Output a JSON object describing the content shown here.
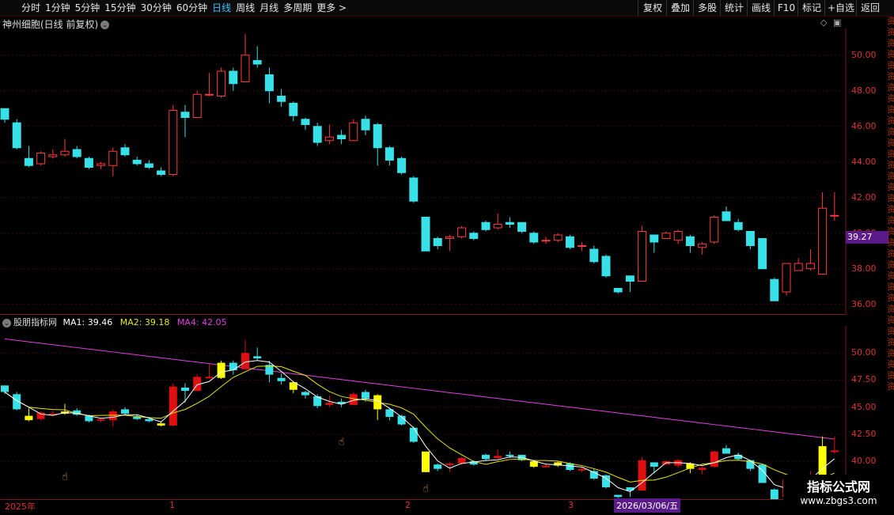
{
  "toolbar": {
    "periods": [
      "分时",
      "1分钟",
      "5分钟",
      "15分钟",
      "30分钟",
      "60分钟",
      "日线",
      "周线",
      "月线",
      "多周期",
      "更多 >"
    ],
    "active_period": "日线",
    "right_buttons": [
      "复权",
      "叠加",
      "多股",
      "统计",
      "画线",
      "F10",
      "标记",
      "+自选",
      "返回"
    ]
  },
  "main_panel": {
    "title": "神州细胞(日线 前复权)",
    "y_ticks": [
      "50.00",
      "48.00",
      "46.00",
      "44.00",
      "42.00",
      "40.00",
      "38.00",
      "36.00"
    ],
    "current_price": "39.27"
  },
  "indicator_panel": {
    "name": "股朋指标网",
    "ma1_label": "MA1: 39.46",
    "ma2_label": "MA2: 39.18",
    "ma4_label": "MA4: 42.05",
    "y_ticks": [
      "50.00",
      "47.50",
      "45.00",
      "42.50",
      "40.00"
    ],
    "colors": {
      "ma1": "#ffffff",
      "ma2": "#e8e800",
      "ma4": "#e040e0"
    }
  },
  "x_axis": {
    "labels": [
      "2025年",
      "1",
      "2",
      "3"
    ],
    "crosshair_date": "2026/03/06/五"
  },
  "watermark": {
    "line1": "指标公式网",
    "line2": "www.zbgs3.com"
  },
  "chart_data": {
    "type": "candlestick",
    "ylim": [
      35.5,
      51.5
    ],
    "candles": [
      [
        47.0,
        46.4,
        47.0,
        46.2
      ],
      [
        46.2,
        44.8,
        46.4,
        44.7
      ],
      [
        44.2,
        43.8,
        44.9,
        43.7
      ],
      [
        43.9,
        44.5,
        44.6,
        43.8
      ],
      [
        44.3,
        44.4,
        44.7,
        44.2
      ],
      [
        44.4,
        44.6,
        45.3,
        44.3
      ],
      [
        44.7,
        44.3,
        44.9,
        44.2
      ],
      [
        44.2,
        43.7,
        44.3,
        43.6
      ],
      [
        43.8,
        43.9,
        44.0,
        43.6
      ],
      [
        43.8,
        44.6,
        44.8,
        43.2
      ],
      [
        44.8,
        44.4,
        45.0,
        44.3
      ],
      [
        44.1,
        43.9,
        44.3,
        43.8
      ],
      [
        43.9,
        43.7,
        44.1,
        43.6
      ],
      [
        43.5,
        43.3,
        43.7,
        43.2
      ],
      [
        43.3,
        46.9,
        47.2,
        43.2
      ],
      [
        46.8,
        46.5,
        47.2,
        45.4
      ],
      [
        46.5,
        47.8,
        48.0,
        46.5
      ],
      [
        47.8,
        47.8,
        49.0,
        47.7
      ],
      [
        47.7,
        49.1,
        49.3,
        47.6
      ],
      [
        49.1,
        48.4,
        49.3,
        48.0
      ],
      [
        48.5,
        50.0,
        51.2,
        48.5
      ],
      [
        49.7,
        49.5,
        50.5,
        49.3
      ],
      [
        48.9,
        48.0,
        49.3,
        47.3
      ],
      [
        47.7,
        47.4,
        48.1,
        47.1
      ],
      [
        47.3,
        46.6,
        47.4,
        46.3
      ],
      [
        46.4,
        46.1,
        46.5,
        45.8
      ],
      [
        46.0,
        45.1,
        46.2,
        44.9
      ],
      [
        45.2,
        45.4,
        46.1,
        45.0
      ],
      [
        45.5,
        45.3,
        45.8,
        45.0
      ],
      [
        45.2,
        46.2,
        46.4,
        45.2
      ],
      [
        46.4,
        45.8,
        46.6,
        45.5
      ],
      [
        46.1,
        44.8,
        46.2,
        43.8
      ],
      [
        44.8,
        44.1,
        44.9,
        43.8
      ],
      [
        44.2,
        43.4,
        44.3,
        43.3
      ],
      [
        43.1,
        41.8,
        43.2,
        41.7
      ],
      [
        40.9,
        39.0,
        40.9,
        39.0
      ],
      [
        39.7,
        39.3,
        39.8,
        39.1
      ],
      [
        39.7,
        39.8,
        39.9,
        39.0
      ],
      [
        39.8,
        40.3,
        40.4,
        39.7
      ],
      [
        40.0,
        39.7,
        40.1,
        39.6
      ],
      [
        40.6,
        40.2,
        40.7,
        40.1
      ],
      [
        40.3,
        40.5,
        41.1,
        40.2
      ],
      [
        40.6,
        40.5,
        40.9,
        40.3
      ],
      [
        40.6,
        40.1,
        40.6,
        40.0
      ],
      [
        40.0,
        39.5,
        40.1,
        39.4
      ],
      [
        39.6,
        39.6,
        39.8,
        39.4
      ],
      [
        39.6,
        39.9,
        40.0,
        39.5
      ],
      [
        39.8,
        39.2,
        39.9,
        39.1
      ],
      [
        39.3,
        39.3,
        39.5,
        39.0
      ],
      [
        39.1,
        38.4,
        39.3,
        38.3
      ],
      [
        38.7,
        37.6,
        38.8,
        37.5
      ],
      [
        36.9,
        36.7,
        36.9,
        36.6
      ],
      [
        37.6,
        37.3,
        37.6,
        36.7
      ],
      [
        37.3,
        40.1,
        40.4,
        37.3
      ],
      [
        39.9,
        39.5,
        39.9,
        38.9
      ],
      [
        39.7,
        40.0,
        40.1,
        39.7
      ],
      [
        39.6,
        40.1,
        40.2,
        39.4
      ],
      [
        39.8,
        39.3,
        39.9,
        38.9
      ],
      [
        39.2,
        39.4,
        39.5,
        38.8
      ],
      [
        39.5,
        40.9,
        41.0,
        39.4
      ],
      [
        41.2,
        40.7,
        41.5,
        40.7
      ],
      [
        40.6,
        40.2,
        40.8,
        40.1
      ],
      [
        40.1,
        39.3,
        40.1,
        39.1
      ],
      [
        39.7,
        38.0,
        39.7,
        38.0
      ],
      [
        37.4,
        36.2,
        37.5,
        36.2
      ],
      [
        36.7,
        38.3,
        38.3,
        36.5
      ],
      [
        37.9,
        38.3,
        38.6,
        37.9
      ],
      [
        38.0,
        38.3,
        39.1,
        37.9
      ],
      [
        37.7,
        41.4,
        42.3,
        37.7
      ],
      [
        41.0,
        41.0,
        42.3,
        40.7
      ]
    ]
  }
}
